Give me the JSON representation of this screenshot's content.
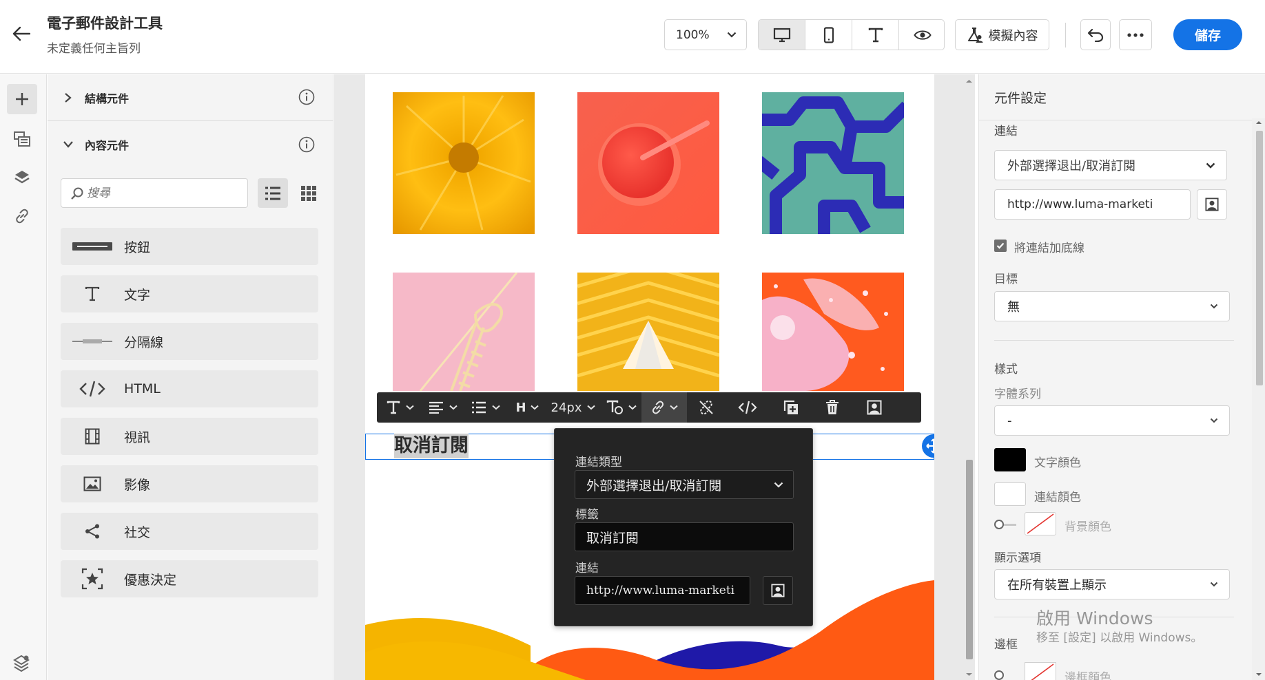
{
  "header": {
    "back_icon": "arrow-left-icon",
    "title": "電子郵件設計工具",
    "subtitle": "未定義任何主旨列",
    "zoom": "100%",
    "view_modes": [
      "desktop-icon",
      "mobile-icon",
      "text-icon",
      "eye-icon"
    ],
    "simulate_label": "模擬內容",
    "undo_icon": "undo-icon",
    "more_icon": "more-icon",
    "save_label": "儲存",
    "accent": "#1473e6"
  },
  "rail": {
    "icons": [
      "plus-icon",
      "fragments-icon",
      "layers-icon",
      "link-icon",
      "settings-stack-icon"
    ]
  },
  "left_panel": {
    "structure_label": "結構元件",
    "content_label": "內容元件",
    "search_placeholder": "搜尋",
    "items": [
      {
        "label": "按鈕",
        "icon": "button-icon"
      },
      {
        "label": "文字",
        "icon": "text-icon"
      },
      {
        "label": "分隔線",
        "icon": "divider-icon"
      },
      {
        "label": "HTML",
        "icon": "code-icon"
      },
      {
        "label": "視訊",
        "icon": "video-icon"
      },
      {
        "label": "影像",
        "icon": "image-icon"
      },
      {
        "label": "社交",
        "icon": "share-icon"
      },
      {
        "label": "優惠決定",
        "icon": "offer-decision-icon"
      }
    ]
  },
  "canvas": {
    "selected_text": "取消訂閱"
  },
  "toolbar": {
    "font_size": "24px",
    "heading": "H"
  },
  "popover": {
    "link_type_label": "連結類型",
    "link_type_value": "外部選擇退出/取消訂閱",
    "label_label": "標籤",
    "label_value": "取消訂閱",
    "link_label": "連結",
    "link_value": "http://www.luma-marketi"
  },
  "right_panel": {
    "title": "元件設定",
    "link_section": "連結",
    "link_type": "外部選擇退出/取消訂閱",
    "url": "http://www.luma-marketi",
    "underline_label": "將連結加底線",
    "target_label": "目標",
    "target_value": "無",
    "style_section": "樣式",
    "font_family_label": "字體系列",
    "font_family_value": "-",
    "text_color_label": "文字顏色",
    "link_color_label": "連結顏色",
    "bg_color_label": "背景顏色",
    "display_label": "顯示選項",
    "display_value": "在所有裝置上顯示",
    "border_label": "邊框",
    "border_color_label": "邊框顏色",
    "text_color": "#000000",
    "link_color": "#ffffff"
  },
  "watermark": {
    "line1": "啟用 Windows",
    "line2": "移至 [設定] 以啟用 Windows。"
  }
}
